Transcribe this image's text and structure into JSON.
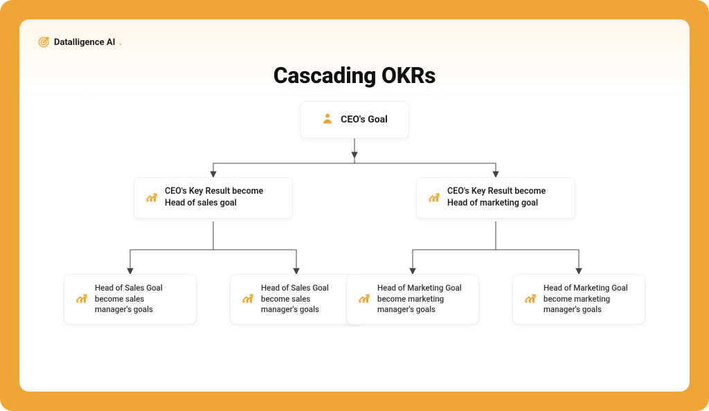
{
  "brand": {
    "name": "Datalligence AI",
    "accent_dot": "."
  },
  "title": "Cascading OKRs",
  "colors": {
    "accent": "#efa634",
    "text": "#111111"
  },
  "nodes": {
    "ceo": {
      "label": "CEO's Goal",
      "icon": "person-icon"
    },
    "sales_head": {
      "line1": "CEO's Key Result become",
      "line2": "Head of sales goal",
      "icon": "chart-icon"
    },
    "marketing_head": {
      "line1": "CEO's Key Result become",
      "line2": "Head of marketing goal",
      "icon": "chart-icon"
    },
    "sales_leaf": {
      "line1": "Head of Sales Goal",
      "line2": "become sales",
      "line3": "manager's goals",
      "icon": "chart-icon"
    },
    "marketing_leaf": {
      "line1": "Head of Marketing Goal",
      "line2": "become marketing",
      "line3": "manager's goals",
      "icon": "chart-icon"
    }
  }
}
